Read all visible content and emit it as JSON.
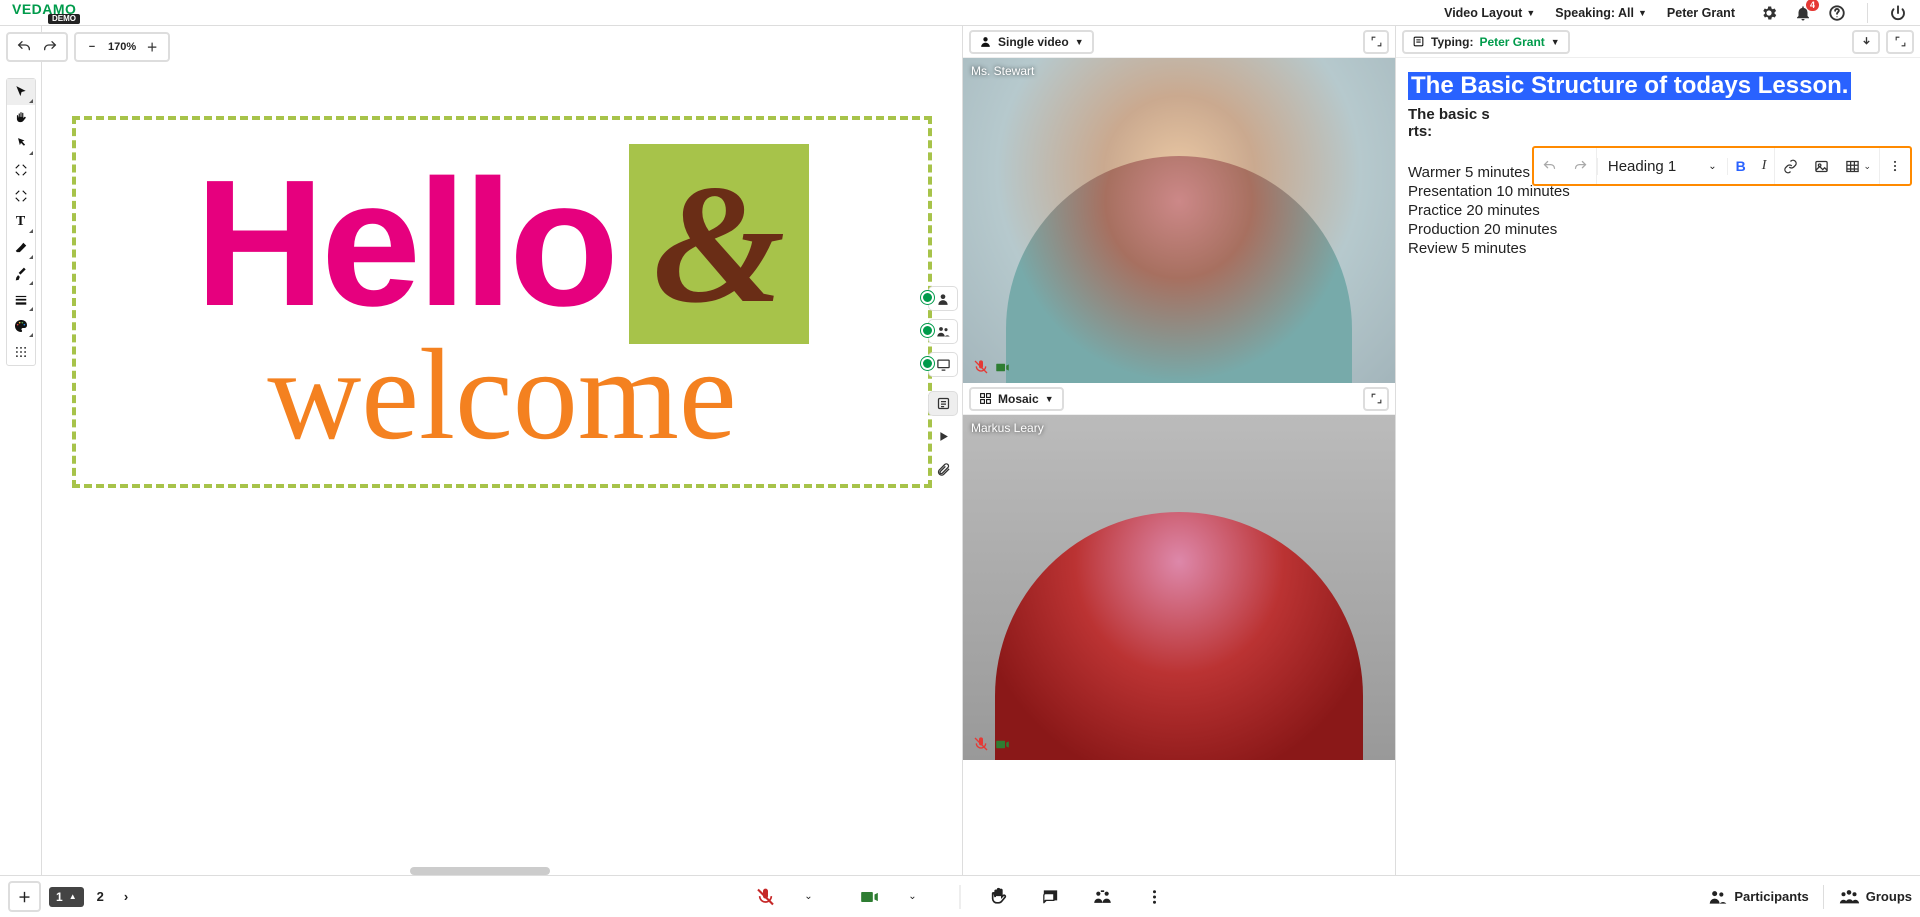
{
  "header": {
    "logo": "VEDAMO",
    "logo_tag": "DEMO",
    "video_layout_label": "Video Layout",
    "speaking_label": "Speaking: All",
    "user_name": "Peter Grant",
    "notification_count": "4"
  },
  "whiteboard": {
    "zoom": "170%",
    "page_current": "1",
    "page_other": "2",
    "hello_text": "Hello",
    "amp_text": "&",
    "welcome_text": "welcome"
  },
  "video": {
    "mode_top": "Single video",
    "mode_bottom": "Mosaic",
    "participant1": "Ms. Stewart",
    "participant2": "Markus Leary"
  },
  "notes": {
    "typing_label": "Typing:",
    "typing_user": "Peter Grant",
    "heading": "The Basic Structure of todays Lesson.",
    "subheading_part1": "The basic s",
    "subheading_part2": "rts:",
    "items": [
      "Warmer 5 minutes",
      "Presentation 10 minutes",
      "Practice 20 minutes",
      "Production 20 minutes",
      "Review  5 minutes"
    ],
    "format_select": "Heading 1"
  },
  "footer": {
    "participants_label": "Participants",
    "groups_label": "Groups"
  }
}
